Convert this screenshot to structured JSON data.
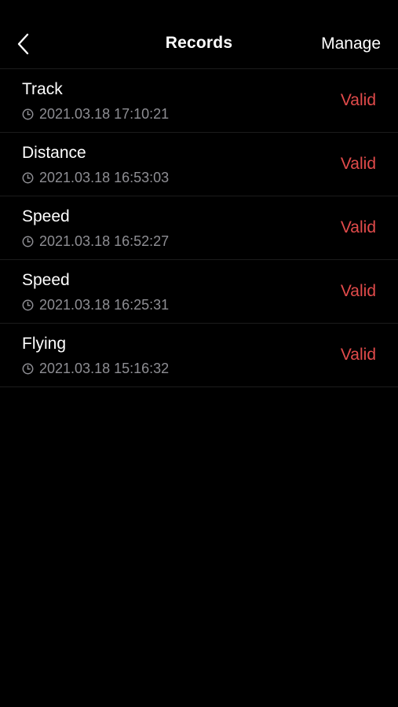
{
  "header": {
    "back_icon": "chevron-left-icon",
    "title": "Records",
    "manage_label": "Manage"
  },
  "records": [
    {
      "name": "Track",
      "time": "2021.03.18 17:10:21",
      "status": "Valid"
    },
    {
      "name": "Distance",
      "time": "2021.03.18 16:53:03",
      "status": "Valid"
    },
    {
      "name": "Speed",
      "time": "2021.03.18 16:52:27",
      "status": "Valid"
    },
    {
      "name": "Speed",
      "time": "2021.03.18 16:25:31",
      "status": "Valid"
    },
    {
      "name": "Flying",
      "time": "2021.03.18 15:16:32",
      "status": "Valid"
    }
  ],
  "colors": {
    "background": "#000000",
    "text": "#ffffff",
    "secondary_text": "#8e8e93",
    "status_valid": "#e24b4b",
    "divider": "#1c1c1c"
  }
}
